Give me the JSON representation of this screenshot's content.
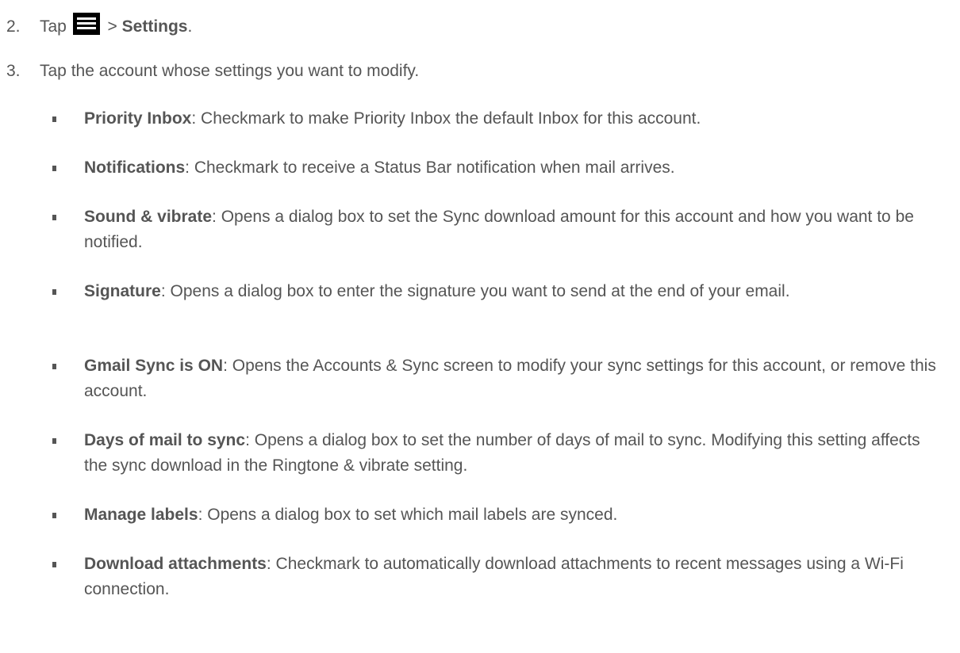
{
  "steps": [
    {
      "num": "2.",
      "text_before": "Tap",
      "icon": "menu-icon",
      "text_mid": " > ",
      "bold": "Settings",
      "text_after": "."
    },
    {
      "num": "3.",
      "text": "Tap the account whose settings you want to modify."
    }
  ],
  "items": [
    {
      "term": "Priority Inbox",
      "desc": ": Checkmark to make Priority Inbox the default Inbox for this account."
    },
    {
      "term": "Notifications",
      "desc": ": Checkmark to receive a Status Bar notification when mail arrives."
    },
    {
      "term": "Sound & vibrate",
      "desc": ": Opens a dialog box to set the Sync download amount for this account and how you want to be notified."
    },
    {
      "term": "Signature",
      "desc": ": Opens a dialog box to enter the signature you want to send at the end of your email."
    },
    {
      "term": "Gmail Sync is ON",
      "desc": ": Opens the Accounts & Sync screen to modify your sync settings for this account, or remove this account."
    },
    {
      "term": "Days of mail to sync",
      "desc": ": Opens a dialog box to set the number of days of mail to sync. Modifying this setting affects the sync download in the Ringtone & vibrate setting."
    },
    {
      "term": "Manage labels",
      "desc": ": Opens a dialog box to set which mail labels are synced."
    },
    {
      "term": "Download attachments",
      "desc": ": Checkmark to automatically download attachments to recent messages using a Wi-Fi connection."
    }
  ]
}
